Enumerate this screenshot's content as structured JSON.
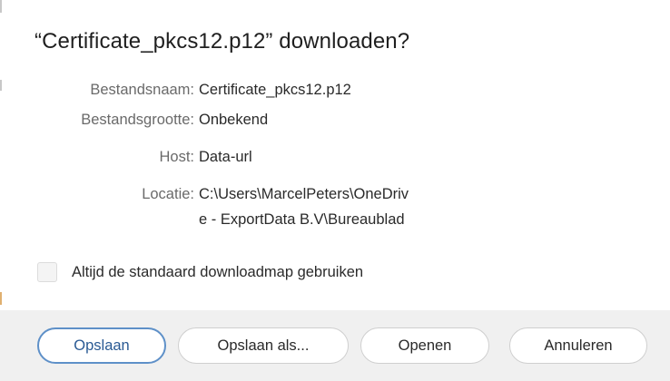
{
  "dialog": {
    "title": "“Certificate_pkcs12.p12” downloaden?",
    "fields": [
      {
        "label": "Bestandsnaam:",
        "value": "Certificate_pkcs12.p12"
      },
      {
        "label": "Bestandsgrootte:",
        "value": "Onbekend"
      },
      {
        "label": "Host:",
        "value": "Data-url"
      },
      {
        "label": "Locatie:",
        "value_line1": "C:\\Users\\MarcelPeters\\OneDriv",
        "value_line2": "e - ExportData B.V\\Bureaublad"
      }
    ],
    "checkbox": {
      "label": "Altijd de standaard downloadmap gebruiken",
      "checked": false
    },
    "buttons": {
      "save": "Opslaan",
      "save_as": "Opslaan als...",
      "open": "Openen",
      "cancel": "Annuleren"
    }
  },
  "colors": {
    "primary_border": "#5e90c8",
    "button_bar": "#f0f0f0"
  }
}
